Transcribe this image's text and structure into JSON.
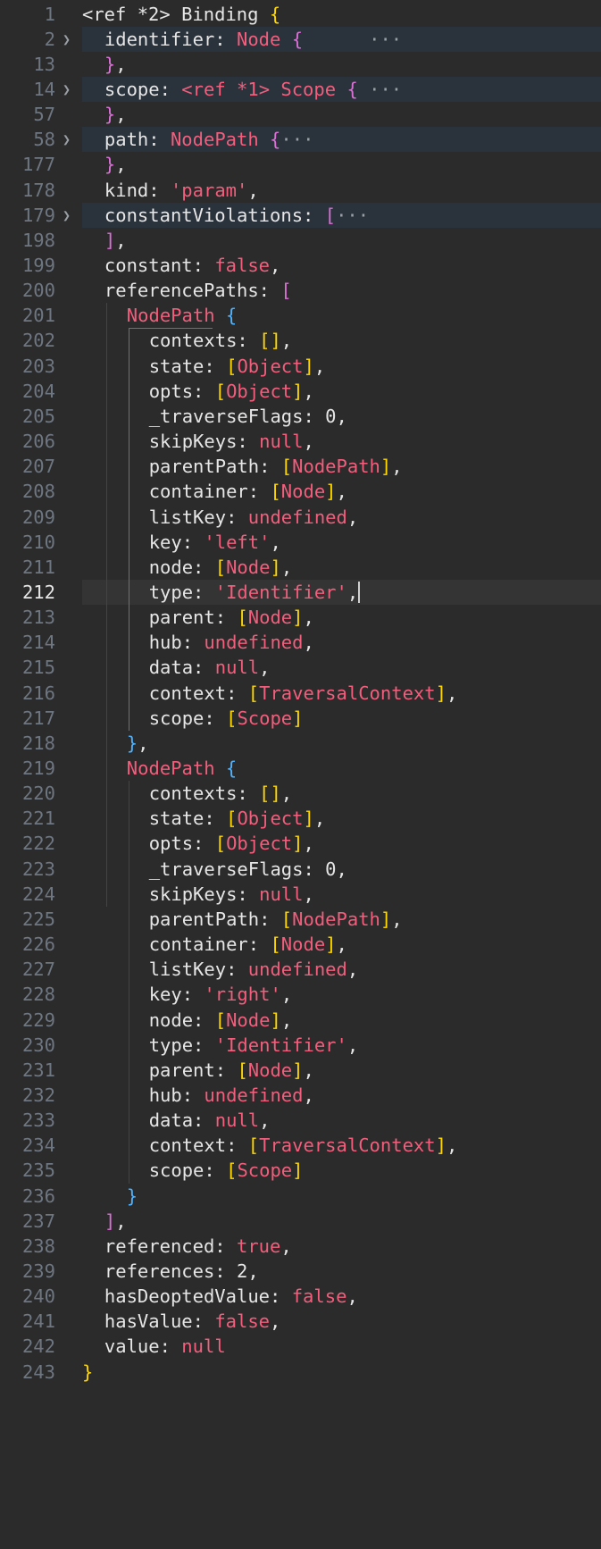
{
  "lines": [
    {
      "n": "1",
      "tokens": [
        [
          "ref",
          "<ref *2> Binding "
        ],
        [
          "b1",
          "{"
        ]
      ]
    },
    {
      "n": "2",
      "indent": 1,
      "chev": true,
      "folded": true,
      "tokens": [
        [
          "key",
          "identifier: "
        ],
        [
          "type",
          "Node "
        ],
        [
          "b2",
          "{"
        ],
        [
          "plain",
          "      "
        ],
        [
          "dots",
          "···"
        ]
      ]
    },
    {
      "n": "13",
      "indent": 1,
      "tokens": [
        [
          "b2",
          "}"
        ],
        [
          "plain",
          ","
        ]
      ]
    },
    {
      "n": "14",
      "indent": 1,
      "chev": true,
      "folded": true,
      "tokens": [
        [
          "key",
          "scope: "
        ],
        [
          "type",
          "<ref *1> Scope "
        ],
        [
          "b2",
          "{"
        ],
        [
          "plain",
          " "
        ],
        [
          "dots",
          "···"
        ]
      ]
    },
    {
      "n": "57",
      "indent": 1,
      "tokens": [
        [
          "b2",
          "}"
        ],
        [
          "plain",
          ","
        ]
      ]
    },
    {
      "n": "58",
      "indent": 1,
      "chev": true,
      "folded": true,
      "tokens": [
        [
          "key",
          "path: "
        ],
        [
          "type",
          "NodePath "
        ],
        [
          "b2",
          "{"
        ],
        [
          "dots",
          "···"
        ]
      ]
    },
    {
      "n": "177",
      "indent": 1,
      "tokens": [
        [
          "b2",
          "}"
        ],
        [
          "plain",
          ","
        ]
      ]
    },
    {
      "n": "178",
      "indent": 1,
      "tokens": [
        [
          "key",
          "kind: "
        ],
        [
          "str",
          "'param'"
        ],
        [
          "plain",
          ","
        ]
      ]
    },
    {
      "n": "179",
      "indent": 1,
      "chev": true,
      "folded": true,
      "tokens": [
        [
          "key",
          "constantViolations: "
        ],
        [
          "b2",
          "["
        ],
        [
          "dots",
          "···"
        ]
      ]
    },
    {
      "n": "198",
      "indent": 1,
      "tokens": [
        [
          "b2",
          "]"
        ],
        [
          "plain",
          ","
        ]
      ]
    },
    {
      "n": "199",
      "indent": 1,
      "tokens": [
        [
          "key",
          "constant: "
        ],
        [
          "kw",
          "false"
        ],
        [
          "plain",
          ","
        ]
      ]
    },
    {
      "n": "200",
      "indent": 1,
      "tokens": [
        [
          "key",
          "referencePaths: "
        ],
        [
          "b2",
          "["
        ]
      ]
    },
    {
      "n": "201",
      "indent": 2,
      "tokens": [
        [
          "type",
          "NodePath "
        ],
        [
          "b3",
          "{"
        ]
      ]
    },
    {
      "n": "202",
      "indent": 3,
      "tokens": [
        [
          "key",
          "contexts: "
        ],
        [
          "b1",
          "[]"
        ],
        [
          "plain",
          ","
        ]
      ]
    },
    {
      "n": "203",
      "indent": 3,
      "tokens": [
        [
          "key",
          "state: "
        ],
        [
          "b1",
          "["
        ],
        [
          "type",
          "Object"
        ],
        [
          "b1",
          "]"
        ],
        [
          "plain",
          ","
        ]
      ]
    },
    {
      "n": "204",
      "indent": 3,
      "tokens": [
        [
          "key",
          "opts: "
        ],
        [
          "b1",
          "["
        ],
        [
          "type",
          "Object"
        ],
        [
          "b1",
          "]"
        ],
        [
          "plain",
          ","
        ]
      ]
    },
    {
      "n": "205",
      "indent": 3,
      "tokens": [
        [
          "key",
          "_traverseFlags: "
        ],
        [
          "num-v",
          "0"
        ],
        [
          "plain",
          ","
        ]
      ]
    },
    {
      "n": "206",
      "indent": 3,
      "tokens": [
        [
          "key",
          "skipKeys: "
        ],
        [
          "kw",
          "null"
        ],
        [
          "plain",
          ","
        ]
      ]
    },
    {
      "n": "207",
      "indent": 3,
      "tokens": [
        [
          "key",
          "parentPath: "
        ],
        [
          "b1",
          "["
        ],
        [
          "type",
          "NodePath"
        ],
        [
          "b1",
          "]"
        ],
        [
          "plain",
          ","
        ]
      ]
    },
    {
      "n": "208",
      "indent": 3,
      "tokens": [
        [
          "key",
          "container: "
        ],
        [
          "b1",
          "["
        ],
        [
          "type",
          "Node"
        ],
        [
          "b1",
          "]"
        ],
        [
          "plain",
          ","
        ]
      ]
    },
    {
      "n": "209",
      "indent": 3,
      "tokens": [
        [
          "key",
          "listKey: "
        ],
        [
          "kw",
          "undefined"
        ],
        [
          "plain",
          ","
        ]
      ]
    },
    {
      "n": "210",
      "indent": 3,
      "tokens": [
        [
          "key",
          "key: "
        ],
        [
          "str",
          "'left'"
        ],
        [
          "plain",
          ","
        ]
      ]
    },
    {
      "n": "211",
      "indent": 3,
      "tokens": [
        [
          "key",
          "node: "
        ],
        [
          "b1",
          "["
        ],
        [
          "type",
          "Node"
        ],
        [
          "b1",
          "]"
        ],
        [
          "plain",
          ","
        ]
      ]
    },
    {
      "n": "212",
      "indent": 3,
      "current": true,
      "cursor": true,
      "tokens": [
        [
          "key",
          "type: "
        ],
        [
          "str",
          "'Identifier'"
        ],
        [
          "plain",
          ","
        ]
      ]
    },
    {
      "n": "213",
      "indent": 3,
      "tokens": [
        [
          "key",
          "parent: "
        ],
        [
          "b1",
          "["
        ],
        [
          "type",
          "Node"
        ],
        [
          "b1",
          "]"
        ],
        [
          "plain",
          ","
        ]
      ]
    },
    {
      "n": "214",
      "indent": 3,
      "tokens": [
        [
          "key",
          "hub: "
        ],
        [
          "kw",
          "undefined"
        ],
        [
          "plain",
          ","
        ]
      ]
    },
    {
      "n": "215",
      "indent": 3,
      "tokens": [
        [
          "key",
          "data: "
        ],
        [
          "kw",
          "null"
        ],
        [
          "plain",
          ","
        ]
      ]
    },
    {
      "n": "216",
      "indent": 3,
      "tokens": [
        [
          "key",
          "context: "
        ],
        [
          "b1",
          "["
        ],
        [
          "type",
          "TraversalContext"
        ],
        [
          "b1",
          "]"
        ],
        [
          "plain",
          ","
        ]
      ]
    },
    {
      "n": "217",
      "indent": 3,
      "tokens": [
        [
          "key",
          "scope: "
        ],
        [
          "b1",
          "["
        ],
        [
          "type",
          "Scope"
        ],
        [
          "b1",
          "]"
        ]
      ]
    },
    {
      "n": "218",
      "indent": 2,
      "tokens": [
        [
          "b3",
          "}"
        ],
        [
          "plain",
          ","
        ]
      ]
    },
    {
      "n": "219",
      "indent": 2,
      "tokens": [
        [
          "type",
          "NodePath "
        ],
        [
          "b3",
          "{"
        ]
      ]
    },
    {
      "n": "220",
      "indent": 3,
      "tokens": [
        [
          "key",
          "contexts: "
        ],
        [
          "b1",
          "[]"
        ],
        [
          "plain",
          ","
        ]
      ]
    },
    {
      "n": "221",
      "indent": 3,
      "tokens": [
        [
          "key",
          "state: "
        ],
        [
          "b1",
          "["
        ],
        [
          "type",
          "Object"
        ],
        [
          "b1",
          "]"
        ],
        [
          "plain",
          ","
        ]
      ]
    },
    {
      "n": "222",
      "indent": 3,
      "tokens": [
        [
          "key",
          "opts: "
        ],
        [
          "b1",
          "["
        ],
        [
          "type",
          "Object"
        ],
        [
          "b1",
          "]"
        ],
        [
          "plain",
          ","
        ]
      ]
    },
    {
      "n": "223",
      "indent": 3,
      "tokens": [
        [
          "key",
          "_traverseFlags: "
        ],
        [
          "num-v",
          "0"
        ],
        [
          "plain",
          ","
        ]
      ]
    },
    {
      "n": "224",
      "indent": 3,
      "tokens": [
        [
          "key",
          "skipKeys: "
        ],
        [
          "kw",
          "null"
        ],
        [
          "plain",
          ","
        ]
      ]
    },
    {
      "n": "225",
      "indent": 3,
      "tokens": [
        [
          "key",
          "parentPath: "
        ],
        [
          "b1",
          "["
        ],
        [
          "type",
          "NodePath"
        ],
        [
          "b1",
          "]"
        ],
        [
          "plain",
          ","
        ]
      ]
    },
    {
      "n": "226",
      "indent": 3,
      "tokens": [
        [
          "key",
          "container: "
        ],
        [
          "b1",
          "["
        ],
        [
          "type",
          "Node"
        ],
        [
          "b1",
          "]"
        ],
        [
          "plain",
          ","
        ]
      ]
    },
    {
      "n": "227",
      "indent": 3,
      "tokens": [
        [
          "key",
          "listKey: "
        ],
        [
          "kw",
          "undefined"
        ],
        [
          "plain",
          ","
        ]
      ]
    },
    {
      "n": "228",
      "indent": 3,
      "tokens": [
        [
          "key",
          "key: "
        ],
        [
          "str",
          "'right'"
        ],
        [
          "plain",
          ","
        ]
      ]
    },
    {
      "n": "229",
      "indent": 3,
      "tokens": [
        [
          "key",
          "node: "
        ],
        [
          "b1",
          "["
        ],
        [
          "type",
          "Node"
        ],
        [
          "b1",
          "]"
        ],
        [
          "plain",
          ","
        ]
      ]
    },
    {
      "n": "230",
      "indent": 3,
      "tokens": [
        [
          "key",
          "type: "
        ],
        [
          "str",
          "'Identifier'"
        ],
        [
          "plain",
          ","
        ]
      ]
    },
    {
      "n": "231",
      "indent": 3,
      "tokens": [
        [
          "key",
          "parent: "
        ],
        [
          "b1",
          "["
        ],
        [
          "type",
          "Node"
        ],
        [
          "b1",
          "]"
        ],
        [
          "plain",
          ","
        ]
      ]
    },
    {
      "n": "232",
      "indent": 3,
      "tokens": [
        [
          "key",
          "hub: "
        ],
        [
          "kw",
          "undefined"
        ],
        [
          "plain",
          ","
        ]
      ]
    },
    {
      "n": "233",
      "indent": 3,
      "tokens": [
        [
          "key",
          "data: "
        ],
        [
          "kw",
          "null"
        ],
        [
          "plain",
          ","
        ]
      ]
    },
    {
      "n": "234",
      "indent": 3,
      "tokens": [
        [
          "key",
          "context: "
        ],
        [
          "b1",
          "["
        ],
        [
          "type",
          "TraversalContext"
        ],
        [
          "b1",
          "]"
        ],
        [
          "plain",
          ","
        ]
      ]
    },
    {
      "n": "235",
      "indent": 3,
      "tokens": [
        [
          "key",
          "scope: "
        ],
        [
          "b1",
          "["
        ],
        [
          "type",
          "Scope"
        ],
        [
          "b1",
          "]"
        ]
      ]
    },
    {
      "n": "236",
      "indent": 2,
      "tokens": [
        [
          "b3",
          "}"
        ]
      ]
    },
    {
      "n": "237",
      "indent": 1,
      "tokens": [
        [
          "b2",
          "]"
        ],
        [
          "plain",
          ","
        ]
      ]
    },
    {
      "n": "238",
      "indent": 1,
      "tokens": [
        [
          "key",
          "referenced: "
        ],
        [
          "kw",
          "true"
        ],
        [
          "plain",
          ","
        ]
      ]
    },
    {
      "n": "239",
      "indent": 1,
      "tokens": [
        [
          "key",
          "references: "
        ],
        [
          "num-v",
          "2"
        ],
        [
          "plain",
          ","
        ]
      ]
    },
    {
      "n": "240",
      "indent": 1,
      "tokens": [
        [
          "key",
          "hasDeoptedValue: "
        ],
        [
          "kw",
          "false"
        ],
        [
          "plain",
          ","
        ]
      ]
    },
    {
      "n": "241",
      "indent": 1,
      "tokens": [
        [
          "key",
          "hasValue: "
        ],
        [
          "kw",
          "false"
        ],
        [
          "plain",
          ","
        ]
      ]
    },
    {
      "n": "242",
      "indent": 1,
      "tokens": [
        [
          "key",
          "value: "
        ],
        [
          "kw",
          "null"
        ]
      ]
    },
    {
      "n": "243",
      "tokens": [
        [
          "b1",
          "}"
        ]
      ]
    }
  ]
}
